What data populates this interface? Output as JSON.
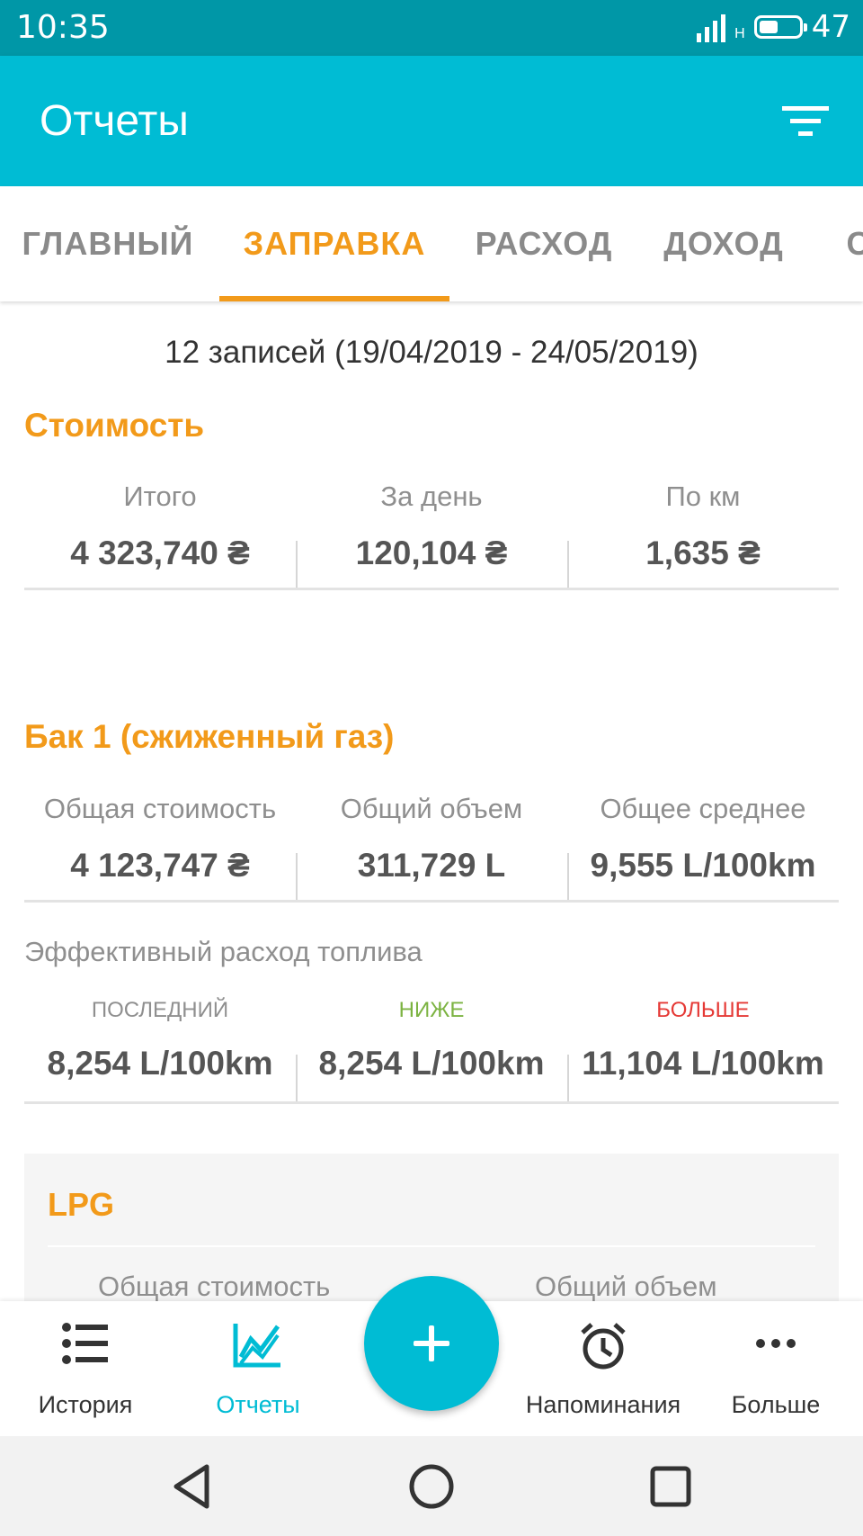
{
  "status_bar": {
    "time": "10:35",
    "network": "H",
    "battery": "47",
    "battery_level": 0.47
  },
  "app_bar": {
    "title": "Отчеты",
    "filter_icon": "filter-icon"
  },
  "tabs": [
    {
      "label": "ГЛАВНЫЙ",
      "active": false
    },
    {
      "label": "ЗАПРАВКА",
      "active": true
    },
    {
      "label": "РАСХОД",
      "active": false
    },
    {
      "label": "ДОХОД",
      "active": false
    },
    {
      "label": "С",
      "active": false
    }
  ],
  "summary": {
    "records": "12 записей (19/04/2019 - 24/05/2019)"
  },
  "cost": {
    "title": "Стоимость",
    "items": [
      {
        "label": "Итого",
        "value": "4 323,740 ₴"
      },
      {
        "label": "За день",
        "value": "120,104 ₴"
      },
      {
        "label": "По км",
        "value": "1,635 ₴"
      }
    ]
  },
  "tank": {
    "title": "Бак 1 (сжиженный газ)",
    "items": [
      {
        "label": "Общая стоимость",
        "value": "4 123,747 ₴"
      },
      {
        "label": "Общий объем",
        "value": "311,729 L"
      },
      {
        "label": "Общее среднее",
        "value": "9,555 L/100km"
      }
    ],
    "efficiency_label": "Эффективный расход топлива",
    "efficiency": [
      {
        "label": "ПОСЛЕДНИЙ",
        "value": "8,254 L/100km",
        "color": "#8f8f8f"
      },
      {
        "label": "НИЖЕ",
        "value": "8,254 L/100km",
        "color": "#7cb342"
      },
      {
        "label": "БОЛЬШЕ",
        "value": "11,104 L/100km",
        "color": "#e53935"
      }
    ]
  },
  "lpg": {
    "title": "LPG",
    "labels": [
      "Общая стоимость",
      "Общий объем"
    ]
  },
  "bottom_nav": [
    {
      "label": "История",
      "icon": "list-icon",
      "active": false
    },
    {
      "label": "Отчеты",
      "icon": "chart-icon",
      "active": true
    },
    {
      "label": "Напоминания",
      "icon": "alarm-clock-icon",
      "active": false
    },
    {
      "label": "Больше",
      "icon": "more-icon",
      "active": false
    }
  ],
  "fab": {
    "icon": "plus-icon"
  },
  "system_nav": [
    "back-icon",
    "home-icon",
    "recents-icon"
  ],
  "colors": {
    "primary": "#00bcd4",
    "primary_dark": "#0097a7",
    "accent": "#f29a1a",
    "good": "#7cb342",
    "bad": "#e53935"
  }
}
